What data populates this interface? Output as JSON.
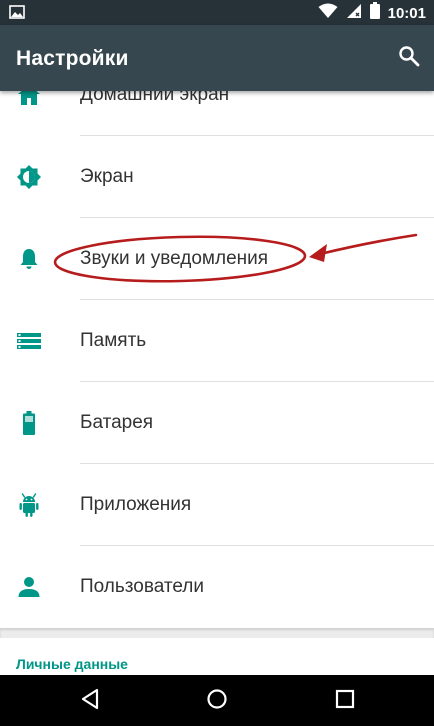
{
  "status_bar": {
    "time": "10:01",
    "icons": [
      "gallery-icon",
      "wifi-icon",
      "signal-icon",
      "battery-icon"
    ]
  },
  "toolbar": {
    "title": "Настройки",
    "search_icon": "search-icon"
  },
  "settings": {
    "items": [
      {
        "label": "Домашний экран",
        "icon": "home-icon"
      },
      {
        "label": "Экран",
        "icon": "brightness-icon"
      },
      {
        "label": "Звуки и уведомления",
        "icon": "bell-icon"
      },
      {
        "label": "Память",
        "icon": "storage-icon"
      },
      {
        "label": "Батарея",
        "icon": "battery-icon"
      },
      {
        "label": "Приложения",
        "icon": "android-icon"
      },
      {
        "label": "Пользователи",
        "icon": "person-icon"
      }
    ],
    "section_header": "Личные данные",
    "highlighted_item": "Звуки и уведомления"
  },
  "nav_bar": {
    "icons": [
      "back-icon",
      "home-button-icon",
      "recents-icon"
    ]
  },
  "colors": {
    "status_bar": "#263238",
    "toolbar": "#37474f",
    "icon_teal": "#009688",
    "section_header": "#009688",
    "annotation_red": "#b71c1c",
    "nav_bar": "#000000"
  }
}
